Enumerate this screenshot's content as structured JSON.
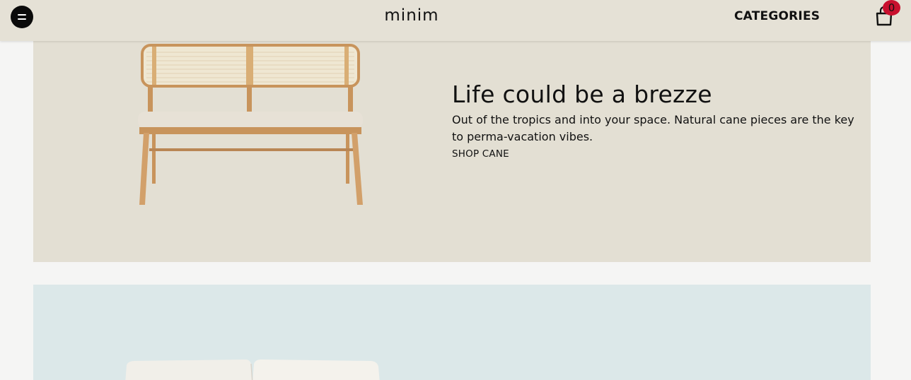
{
  "header": {
    "logo": "minim",
    "categories_label": "CATEGORIES",
    "cart_count": "0",
    "menu_icon": "hamburger-menu-icon",
    "cart_icon": "shopping-bag-icon"
  },
  "promo_cane": {
    "title": "Life could be a brezze",
    "description": "Out of the tropics and into your space. Natural cane pieces are the key to perma-vacation vibes.",
    "link_label": "SHOP CANE",
    "image": "cane-bench-image"
  },
  "promo_next": {
    "image": "sofa-image"
  },
  "colors": {
    "header_bg": "#e5e1d6",
    "cane_banner_bg": "#e3dfd3",
    "sofa_banner_bg": "#dce8e9",
    "page_bg": "#f5f5f4",
    "badge": "#c8102e"
  }
}
